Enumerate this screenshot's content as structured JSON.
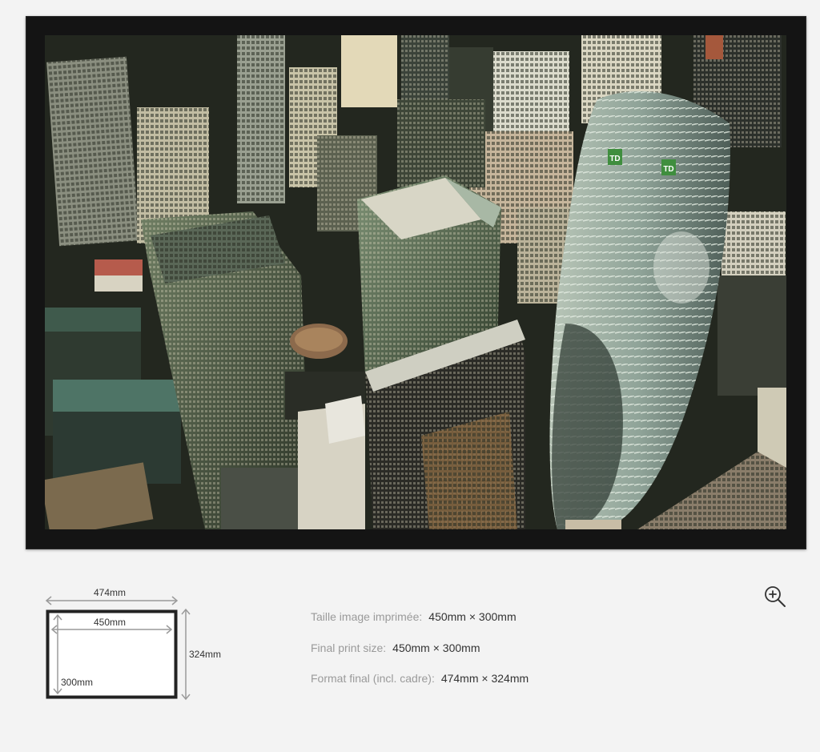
{
  "artwork": {
    "subject": "aerial-city-skyline-photo"
  },
  "diagram": {
    "outer_width": "474mm",
    "inner_width": "450mm",
    "outer_height": "324mm",
    "inner_height": "300mm"
  },
  "info": {
    "rows": [
      {
        "label": "Taille image imprimée",
        "value": "450mm × 300mm"
      },
      {
        "label": "Final print size",
        "value": "450mm × 300mm"
      },
      {
        "label": "Format final (incl. cadre)",
        "value": "474mm × 324mm"
      }
    ],
    "separator": ":"
  },
  "icons": {
    "zoom": "zoom-in-icon"
  },
  "colors": {
    "background": "#f3f3f3",
    "frame": "#141414",
    "label": "#9a9a9a",
    "value": "#333333",
    "dimension_line": "#9a9a9a"
  }
}
